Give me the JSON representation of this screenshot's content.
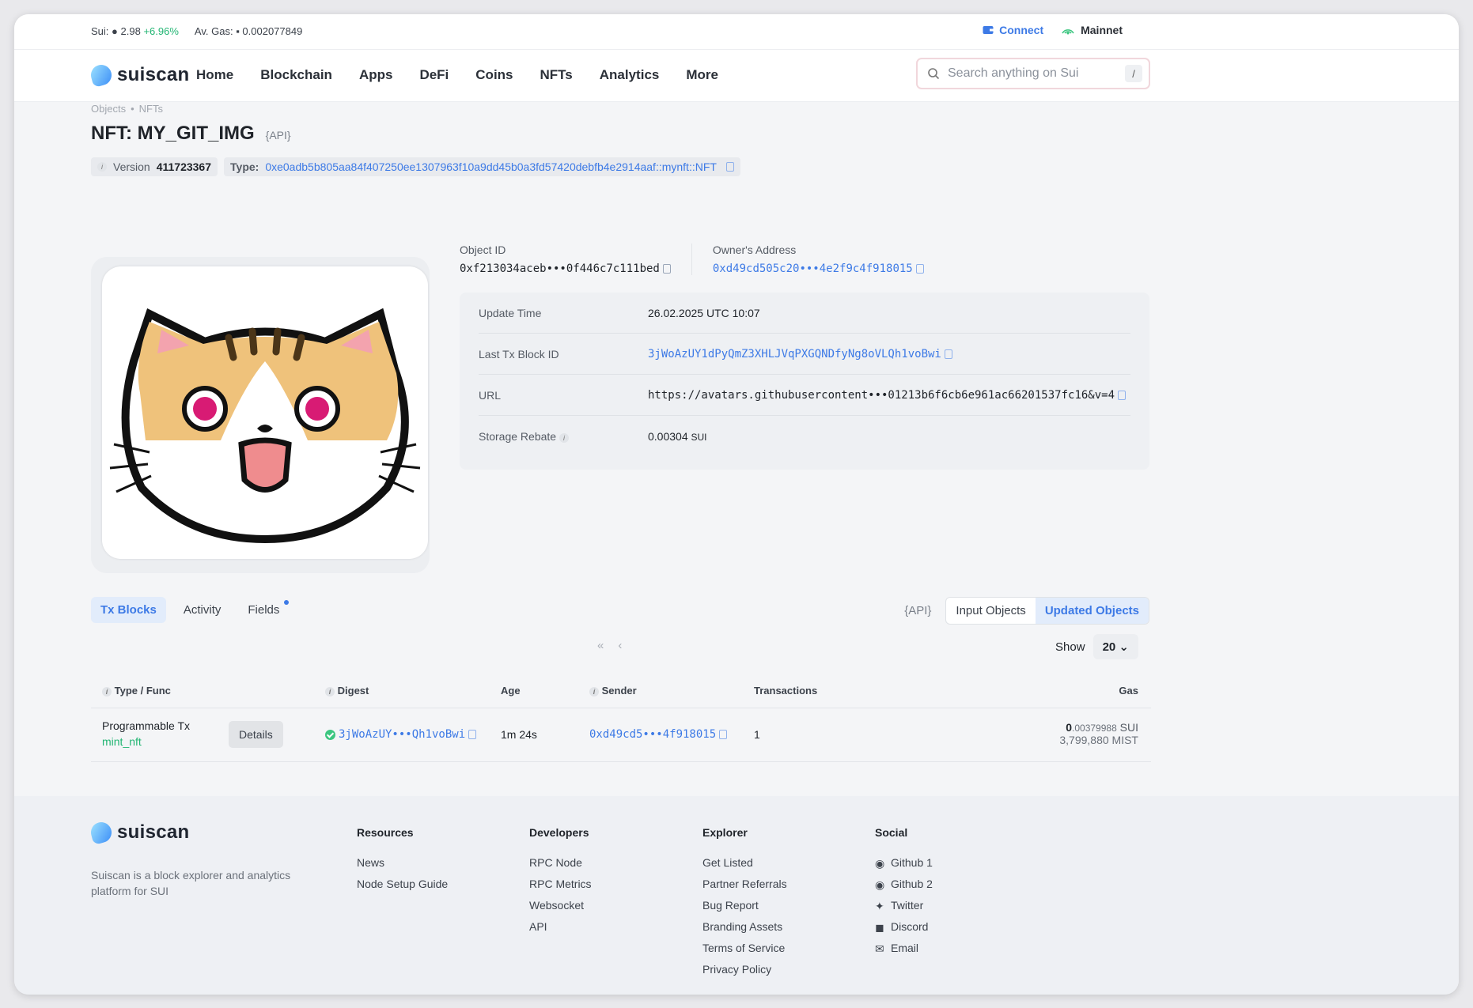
{
  "topbar": {
    "sui_label": "Sui:",
    "sui_price": "2.98",
    "sui_change": "+6.96%",
    "gas_label": "Av. Gas:",
    "gas_value": "0.002077849",
    "connect": "Connect",
    "network": "Mainnet"
  },
  "nav": {
    "logo": "suiscan",
    "items": [
      "Home",
      "Blockchain",
      "Apps",
      "DeFi",
      "Coins",
      "NFTs",
      "Analytics",
      "More"
    ],
    "search_placeholder": "Search anything on Sui",
    "search_shortcut": "/"
  },
  "breadcrumb": [
    "Objects",
    "NFTs"
  ],
  "page": {
    "title": "NFT: MY_GIT_IMG",
    "api": "{API}",
    "version_label": "Version",
    "version": "411723367",
    "type_label": "Type:",
    "type_value": "0xe0adb5b805aa84f407250ee1307963f10a9dd45b0a3fd57420debfb4e2914aaf::mynft::NFT"
  },
  "ids": {
    "object_id_label": "Object ID",
    "object_id": "0xf213034aceb•••0f446c7c111bed",
    "owner_label": "Owner's Address",
    "owner": "0xd49cd505c20•••4e2f9c4f918015"
  },
  "details": [
    {
      "key": "Update Time",
      "value": "26.02.2025 UTC 10:07"
    },
    {
      "key": "Last Tx Block ID",
      "value": "3jWoAzUY1dPyQmZ3XHLJVqPXGQNDfyNg8oVLQh1voBwi"
    },
    {
      "key": "URL",
      "value": "https://avatars.githubusercontent•••01213b6f6cb6e961ac66201537fc16&v=4"
    },
    {
      "key": "Storage Rebate",
      "value": "0.00304",
      "unit": "SUI"
    }
  ],
  "tabs": [
    "Tx Blocks",
    "Activity",
    "Fields"
  ],
  "object_toggle": [
    "Input Objects",
    "Updated Objects"
  ],
  "pager": {
    "first": "«",
    "prev": "‹",
    "show_label": "Show",
    "show_value": "20"
  },
  "table": {
    "headers": [
      "Type / Func",
      "Digest",
      "Age",
      "Sender",
      "Transactions",
      "Gas"
    ],
    "rows": [
      {
        "type": "Programmable Tx",
        "func": "mint_nft",
        "details": "Details",
        "digest": "3jWoAzUY•••Qh1voBwi",
        "age": "1m 24s",
        "sender": "0xd49cd5•••4f918015",
        "transactions": "1",
        "gas_main": "0",
        "gas_frac": ".00379988",
        "gas_unit": "SUI",
        "gas_mist": "3,799,880 MIST"
      }
    ]
  },
  "footer": {
    "logo": "suiscan",
    "desc": "Suiscan is a block explorer and analytics platform for SUI",
    "columns": [
      {
        "title": "Resources",
        "items": [
          "News",
          "Node Setup Guide"
        ]
      },
      {
        "title": "Developers",
        "items": [
          "RPC Node",
          "RPC Metrics",
          "Websocket",
          "API"
        ]
      },
      {
        "title": "Explorer",
        "items": [
          "Get Listed",
          "Partner Referrals",
          "Bug Report",
          "Branding Assets",
          "Terms of Service",
          "Privacy Policy"
        ]
      },
      {
        "title": "Social",
        "items": [
          "Github 1",
          "Github 2",
          "Twitter",
          "Discord",
          "Email"
        ]
      }
    ]
  },
  "colors": {
    "accent": "#3d7ae6",
    "positive": "#22b573",
    "background": "#f4f5f7"
  }
}
